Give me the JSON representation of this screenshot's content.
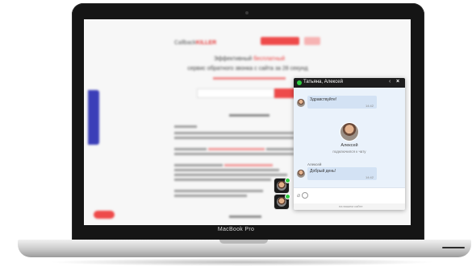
{
  "device": {
    "brand_label": "MacBook Pro"
  },
  "site": {
    "logo_text": "Callback",
    "logo_accent": "KILLER",
    "headline_part1": "Эффективный",
    "headline_accent": "бесплатный",
    "headline_line2": "сервис обратного звонка с сайта за 28 секунд"
  },
  "chat": {
    "title": "Татьяна, Алексей",
    "minimize_icon": "chevron-left-icon",
    "close_icon": "close-icon",
    "messages": [
      {
        "text": "Здравствуйте!",
        "time": "14:42"
      }
    ],
    "join": {
      "name": "Алексей",
      "status": "подключился к чату"
    },
    "reply": {
      "sender": "Алексей",
      "text": "Добрый день!",
      "time": "14:42"
    },
    "input_placeholder": "",
    "powered_by": "на вашем сайте"
  },
  "colors": {
    "accent_red": "#ee4a4a",
    "online_green": "#2ecc40",
    "chat_header": "#1d1d1d",
    "bubble": "#d3e2f4"
  }
}
